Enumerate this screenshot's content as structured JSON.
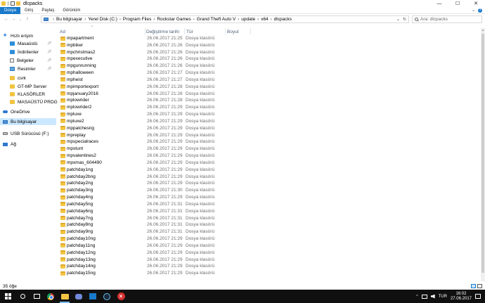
{
  "window": {
    "title": "dlcpacks",
    "controls": [
      "—",
      "☐",
      "✕"
    ]
  },
  "ribbon": {
    "tabs": [
      "Dosya",
      "Giriş",
      "Paylaş",
      "Görünüm"
    ]
  },
  "address": {
    "crumbs": [
      "Bu bilgisayar",
      "Yerel Disk (C:)",
      "Program Files",
      "Rockstar Games",
      "Grand Theft Auto V",
      "update",
      "x64",
      "dlcpacks"
    ],
    "search_placeholder": "Ara: dlcpacks"
  },
  "nav": {
    "items": [
      {
        "label": "Hızlı erişim",
        "icon": "star-icon",
        "pinned": false
      },
      {
        "label": "Masaüstü",
        "icon": "desktop-icon",
        "pinned": true
      },
      {
        "label": "İndirilenler",
        "icon": "download-icon",
        "pinned": true
      },
      {
        "label": "Belgeler",
        "icon": "documents-icon",
        "pinned": true
      },
      {
        "label": "Resimler",
        "icon": "pictures-icon",
        "pinned": true
      },
      {
        "label": "csrk",
        "icon": "folder-icon",
        "pinned": false
      },
      {
        "label": "GT-MP Server",
        "icon": "folder-icon",
        "pinned": false
      },
      {
        "label": "KLASÖRLER",
        "icon": "folder-icon",
        "pinned": false
      },
      {
        "label": "MASAÜSTÜ PRDG",
        "icon": "folder-icon",
        "pinned": false
      },
      {
        "label": "OneDrive",
        "icon": "onedrive-icon",
        "pinned": false
      },
      {
        "label": "Bu bilgisayar",
        "icon": "this-pc-icon",
        "pinned": false,
        "selected": true
      },
      {
        "label": "USB Sürücüsü (F:)",
        "icon": "usb-drive-icon",
        "pinned": false
      },
      {
        "label": "Ağ",
        "icon": "network-icon",
        "pinned": false
      }
    ]
  },
  "columns": {
    "name": "Ad",
    "date": "Değiştirme tarihi",
    "type": "Tür",
    "size": "Boyut"
  },
  "files": [
    {
      "name": "mpapartment",
      "date": "26.06.2017 21:25",
      "type": "Dosya klasörü"
    },
    {
      "name": "mpbiker",
      "date": "26.06.2017 21:26",
      "type": "Dosya klasörü"
    },
    {
      "name": "mpchristmas2",
      "date": "26.06.2017 21:26",
      "type": "Dosya klasörü"
    },
    {
      "name": "mpexecutive",
      "date": "26.06.2017 21:26",
      "type": "Dosya klasörü"
    },
    {
      "name": "mpgunrunning",
      "date": "26.06.2017 21:26",
      "type": "Dosya klasörü"
    },
    {
      "name": "mphalloween",
      "date": "26.06.2017 21:27",
      "type": "Dosya klasörü"
    },
    {
      "name": "mpheist",
      "date": "26.06.2017 21:27",
      "type": "Dosya klasörü"
    },
    {
      "name": "mpimportexport",
      "date": "26.06.2017 21:28",
      "type": "Dosya klasörü"
    },
    {
      "name": "mpjanuary2016",
      "date": "26.06.2017 21:28",
      "type": "Dosya klasörü"
    },
    {
      "name": "mplowrider",
      "date": "26.06.2017 21:28",
      "type": "Dosya klasörü"
    },
    {
      "name": "mplowrider2",
      "date": "26.06.2017 21:29",
      "type": "Dosya klasörü"
    },
    {
      "name": "mpluxe",
      "date": "26.06.2017 21:29",
      "type": "Dosya klasörü"
    },
    {
      "name": "mpluxe2",
      "date": "26.06.2017 21:29",
      "type": "Dosya klasörü"
    },
    {
      "name": "mppatchesng",
      "date": "26.06.2017 21:29",
      "type": "Dosya klasörü"
    },
    {
      "name": "mpreplay",
      "date": "26.06.2017 21:29",
      "type": "Dosya klasörü"
    },
    {
      "name": "mpspecialraces",
      "date": "26.06.2017 21:29",
      "type": "Dosya klasörü"
    },
    {
      "name": "mpstunt",
      "date": "26.06.2017 21:29",
      "type": "Dosya klasörü"
    },
    {
      "name": "mpvalentines2",
      "date": "26.06.2017 21:29",
      "type": "Dosya klasörü"
    },
    {
      "name": "mpxmas_604490",
      "date": "26.06.2017 21:29",
      "type": "Dosya klasörü"
    },
    {
      "name": "patchday1ng",
      "date": "26.06.2017 21:29",
      "type": "Dosya klasörü"
    },
    {
      "name": "patchday2bng",
      "date": "26.06.2017 21:29",
      "type": "Dosya klasörü"
    },
    {
      "name": "patchday2ng",
      "date": "26.06.2017 21:29",
      "type": "Dosya klasörü"
    },
    {
      "name": "patchday3ng",
      "date": "26.06.2017 21:30",
      "type": "Dosya klasörü"
    },
    {
      "name": "patchday4ng",
      "date": "26.06.2017 21:29",
      "type": "Dosya klasörü"
    },
    {
      "name": "patchday5ng",
      "date": "26.06.2017 21:31",
      "type": "Dosya klasörü"
    },
    {
      "name": "patchday6ng",
      "date": "26.06.2017 21:31",
      "type": "Dosya klasörü"
    },
    {
      "name": "patchday7ng",
      "date": "26.06.2017 21:31",
      "type": "Dosya klasörü"
    },
    {
      "name": "patchday8ng",
      "date": "26.06.2017 21:31",
      "type": "Dosya klasörü"
    },
    {
      "name": "patchday9ng",
      "date": "26.06.2017 21:31",
      "type": "Dosya klasörü"
    },
    {
      "name": "patchday10ng",
      "date": "26.06.2017 21:29",
      "type": "Dosya klasörü"
    },
    {
      "name": "patchday11ng",
      "date": "26.06.2017 21:29",
      "type": "Dosya klasörü"
    },
    {
      "name": "patchday12ng",
      "date": "26.06.2017 21:29",
      "type": "Dosya klasörü"
    },
    {
      "name": "patchday13ng",
      "date": "26.06.2017 21:29",
      "type": "Dosya klasörü"
    },
    {
      "name": "patchday14ng",
      "date": "26.06.2017 21:29",
      "type": "Dosya klasörü"
    },
    {
      "name": "patchday15ng",
      "date": "26.06.2017 21:29",
      "type": "Dosya klasörü"
    }
  ],
  "status": {
    "item_count": "35 öğe"
  },
  "taskbar": {
    "language": "TUR",
    "time": "16:02",
    "date": "27.06.2017"
  },
  "colors": {
    "accent": "#1979ca",
    "selected_bg": "#cce8ff",
    "folder": "#f3c443"
  }
}
